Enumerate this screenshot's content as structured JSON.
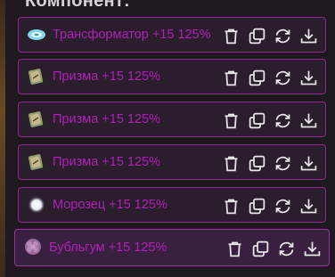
{
  "panel": {
    "heading": "Компонент:"
  },
  "items": [
    {
      "label": "Трансформатор +15 125%",
      "icon": "transformer-icon"
    },
    {
      "label": "Призма +15 125%",
      "icon": "prism-card-icon"
    },
    {
      "label": "Призма +15 125%",
      "icon": "prism-card-icon"
    },
    {
      "label": "Призма +15 125%",
      "icon": "prism-card-icon"
    },
    {
      "label": "Морозец +15 125%",
      "icon": "frost-orb-icon"
    },
    {
      "label": "Бубльгум +15 125%",
      "icon": "bubblegum-icon"
    }
  ],
  "actions": [
    "delete-icon",
    "copy-icon",
    "refresh-icon",
    "download-icon"
  ],
  "colors": {
    "accent": "#b020b8",
    "border": "#8c2a8e",
    "icon": "#e8e8e8"
  }
}
